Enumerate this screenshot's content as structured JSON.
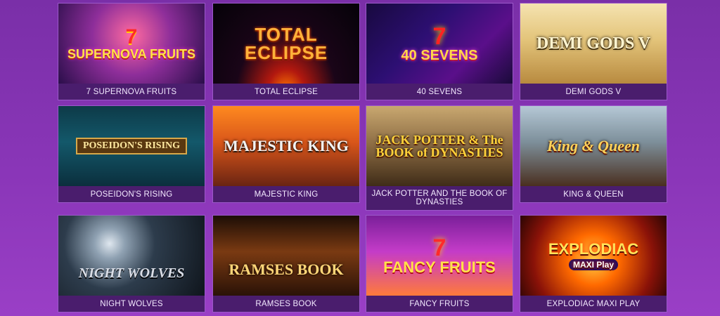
{
  "games": [
    {
      "label": "7 SUPERNOVA FRUITS",
      "art": {
        "top": "7",
        "title": "SUPERNOVA FRUITS"
      }
    },
    {
      "label": "TOTAL ECLIPSE",
      "art": {
        "title": "TOTAL ECLIPSE"
      }
    },
    {
      "label": "40 SEVENS",
      "art": {
        "top": "7",
        "title": "40 SEVENS"
      }
    },
    {
      "label": "DEMI GODS V",
      "art": {
        "title": "DEMI GODS V"
      }
    },
    {
      "label": "POSEIDON'S RISING",
      "art": {
        "title": "POSEIDON'S RISING"
      }
    },
    {
      "label": "MAJESTIC KING",
      "art": {
        "title": "MAJESTIC KING"
      }
    },
    {
      "label": "JACK POTTER AND THE BOOK OF DYNASTIES",
      "art": {
        "title": "JACK POTTER & The BOOK of DYNASTIES"
      }
    },
    {
      "label": "KING & QUEEN",
      "art": {
        "title": "King & Queen"
      }
    },
    {
      "label": "NIGHT WOLVES",
      "art": {
        "title": "NIGHT WOLVES"
      }
    },
    {
      "label": "RAMSES BOOK",
      "art": {
        "title": "RAMSES BOOK"
      }
    },
    {
      "label": "FANCY FRUITS",
      "art": {
        "top": "7",
        "title": "FANCY FRUITS"
      }
    },
    {
      "label": "EXPLODIAC MAXI PLAY",
      "art": {
        "title": "EXPLODIAC",
        "sub": "MAXI Play"
      }
    }
  ]
}
